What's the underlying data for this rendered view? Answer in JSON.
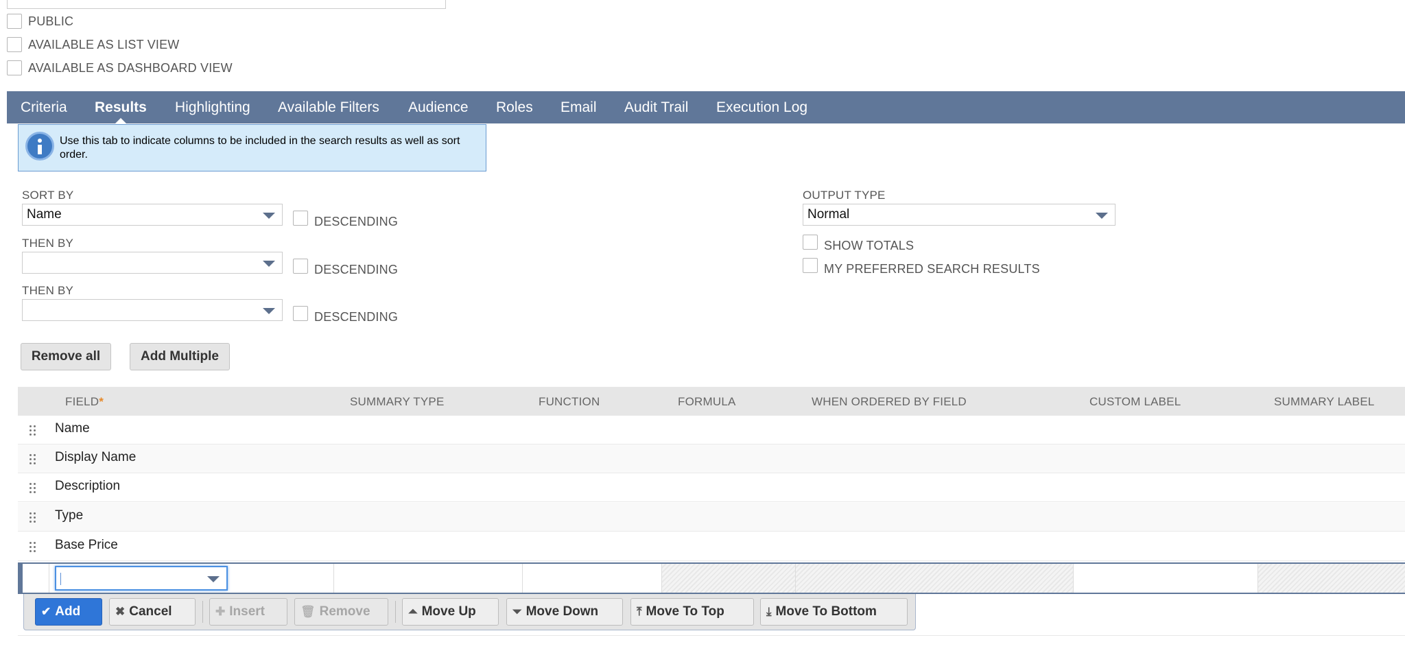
{
  "options": {
    "public_label": "PUBLIC",
    "list_view_label": "AVAILABLE AS LIST VIEW",
    "dashboard_view_label": "AVAILABLE AS DASHBOARD VIEW"
  },
  "tabs": [
    {
      "label": "Criteria"
    },
    {
      "label": "Results",
      "active": true
    },
    {
      "label": "Highlighting"
    },
    {
      "label": "Available Filters"
    },
    {
      "label": "Audience"
    },
    {
      "label": "Roles"
    },
    {
      "label": "Email"
    },
    {
      "label": "Audit Trail"
    },
    {
      "label": "Execution Log"
    }
  ],
  "info": {
    "text": "Use this tab to indicate columns to be included in the search results as well as sort order."
  },
  "sort": {
    "sort_by_label": "SORT BY",
    "sort_by_value": "Name",
    "then_by_label": "THEN BY",
    "then_by_1_value": "",
    "then_by_2_value": "",
    "descending_label": "DESCENDING"
  },
  "output": {
    "label": "OUTPUT TYPE",
    "value": "Normal",
    "show_totals_label": "SHOW TOTALS",
    "preferred_label": "MY PREFERRED SEARCH RESULTS"
  },
  "actions": {
    "remove_all": "Remove all",
    "add_multiple": "Add Multiple"
  },
  "table": {
    "field_header": "FIELD",
    "required_mark": "*",
    "headers": [
      "SUMMARY TYPE",
      "FUNCTION",
      "FORMULA",
      "WHEN ORDERED BY FIELD",
      "CUSTOM LABEL",
      "SUMMARY LABEL"
    ],
    "rows": [
      "Name",
      "Display Name",
      "Description",
      "Type",
      "Base Price"
    ]
  },
  "toolbar": {
    "add": "Add",
    "cancel": "Cancel",
    "insert": "Insert",
    "remove": "Remove",
    "move_up": "Move Up",
    "move_down": "Move Down",
    "move_top": "Move To Top",
    "move_bottom": "Move To Bottom"
  },
  "colors": {
    "tab_bar": "#607799",
    "primary_button": "#2f76d8",
    "info_bg": "#d5ebfa"
  }
}
